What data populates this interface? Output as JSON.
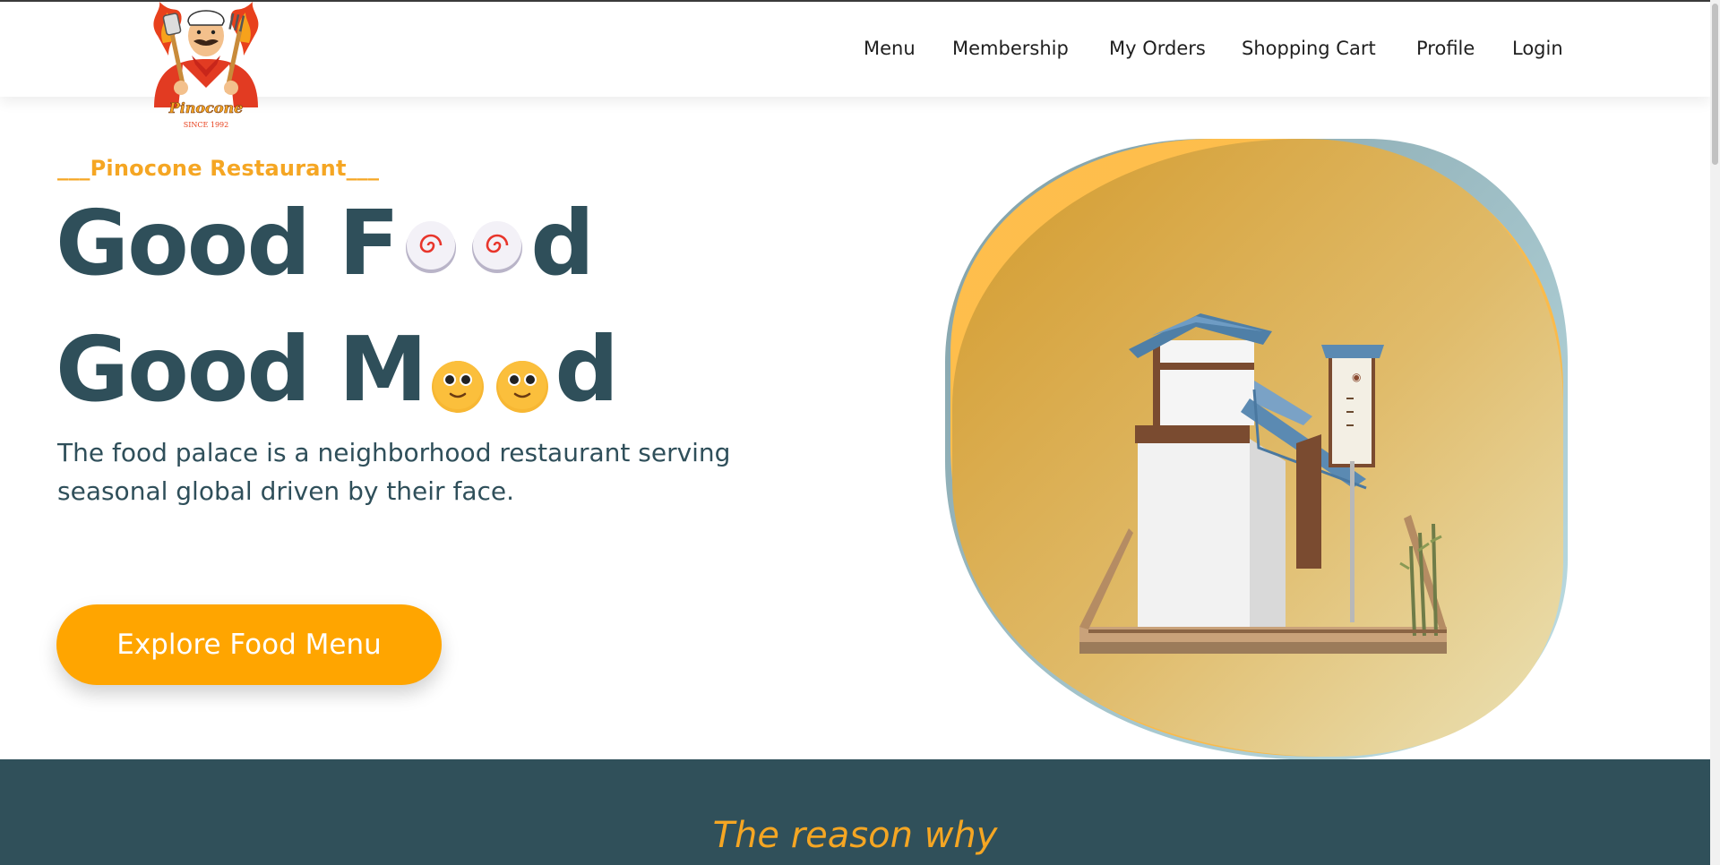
{
  "brand": {
    "logo_icon": "chef-mascot-logo",
    "logo_text": "Pinocone",
    "logo_since": "SINCE 1992"
  },
  "nav": {
    "items": [
      {
        "label": "Menu"
      },
      {
        "label": "Membership"
      },
      {
        "label": "My Orders"
      },
      {
        "label": "Shopping Cart"
      },
      {
        "label": "Profile"
      },
      {
        "label": "Login"
      }
    ]
  },
  "hero": {
    "tagline": "___Pinocone Restaurant___",
    "line1_start": "Good F",
    "line1_end": "d",
    "line2_start": "Good M",
    "line2_end": "d",
    "description": "The food palace is a neighborhood restaurant serving seasonal global driven by their face.",
    "cta_label": "Explore Food Menu",
    "icons": [
      "fish-cake-icon",
      "smiley-face-icon"
    ],
    "art": "japanese-restaurant-building-illustration"
  },
  "reason": {
    "title": "The reason why"
  },
  "colors": {
    "accent": "#ffa500",
    "tagline": "#f5a623",
    "text_dark": "#2f4f5a",
    "band": "#30505a"
  }
}
